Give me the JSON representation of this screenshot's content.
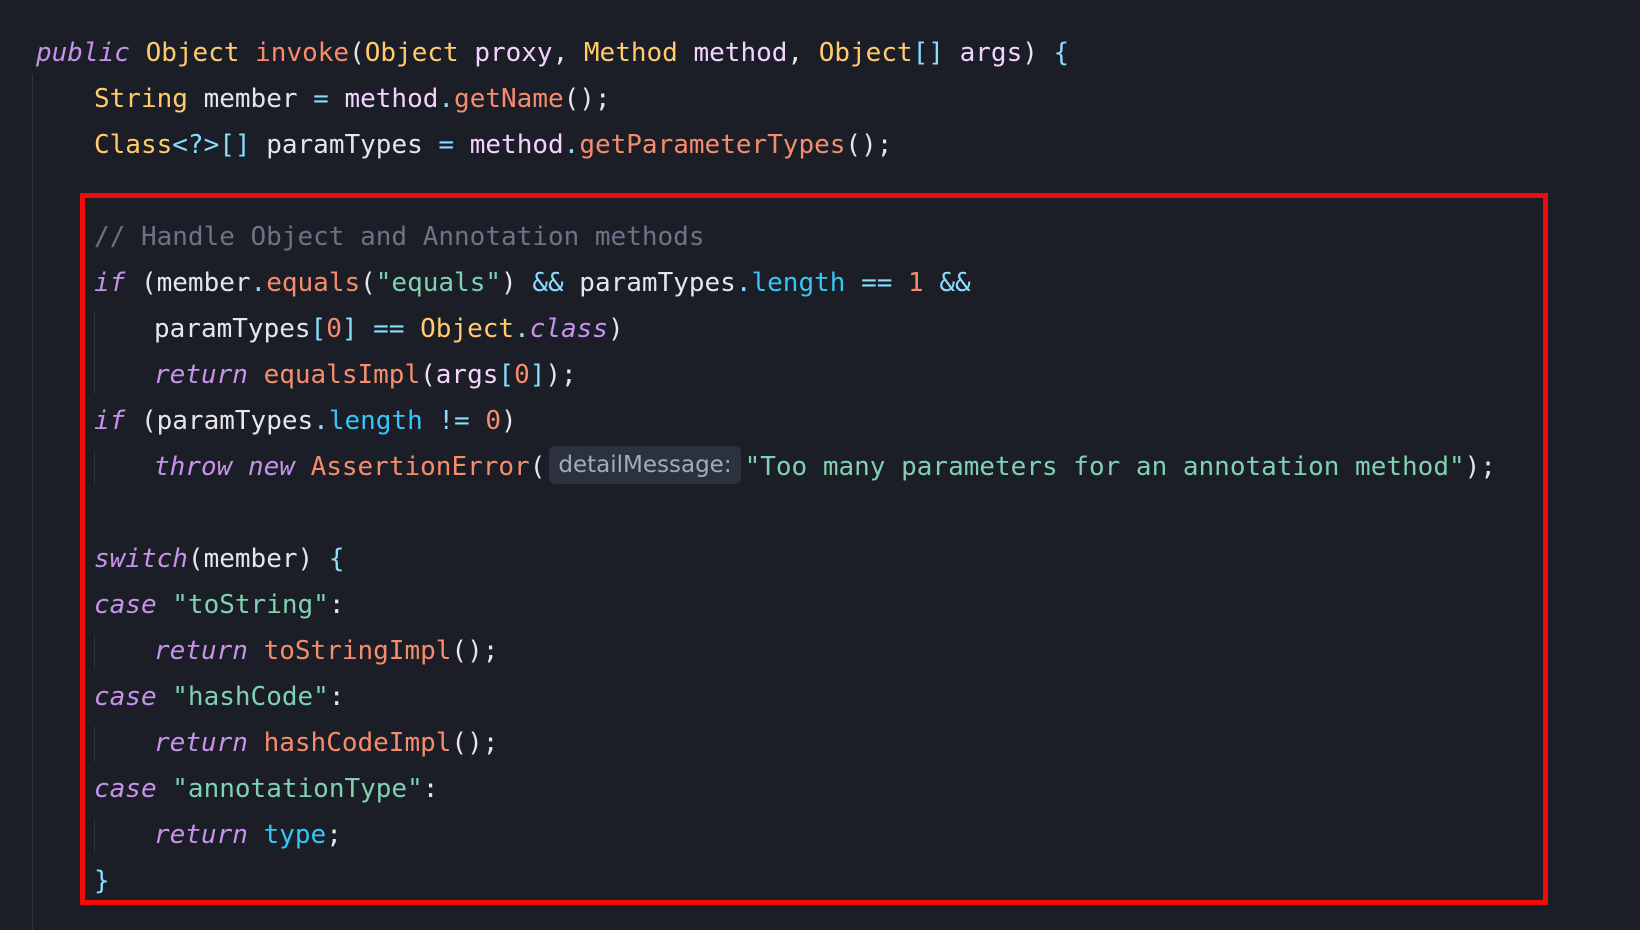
{
  "editor": {
    "colors": {
      "background": "#1b1e27",
      "keyword": "#c792ea",
      "type": "#ffcb6b",
      "function": "#f78c6c",
      "variable": "#f4d3ff",
      "punctuation": "#e6e6ea",
      "operator": "#89ddff",
      "string": "#7fd1b0",
      "number": "#f78c6c",
      "property": "#36c6f4",
      "comment": "#6b7386",
      "highlight_border": "#f20b0b"
    },
    "highlight": {
      "label": "selected-code-region"
    },
    "lines": [
      {
        "indent": 0,
        "tokens": [
          {
            "t": "public",
            "c": "keyword",
            "i": true
          },
          {
            "t": " "
          },
          {
            "t": "Object",
            "c": "type"
          },
          {
            "t": " "
          },
          {
            "t": "invoke",
            "c": "function"
          },
          {
            "t": "(",
            "c": "punctuation"
          },
          {
            "t": "Object",
            "c": "type"
          },
          {
            "t": " "
          },
          {
            "t": "proxy",
            "c": "variable"
          },
          {
            "t": ", ",
            "c": "punctuation"
          },
          {
            "t": "Method",
            "c": "type"
          },
          {
            "t": " "
          },
          {
            "t": "method",
            "c": "variable"
          },
          {
            "t": ", ",
            "c": "punctuation"
          },
          {
            "t": "Object",
            "c": "type"
          },
          {
            "t": "[]",
            "c": "operator"
          },
          {
            "t": " "
          },
          {
            "t": "args",
            "c": "variable"
          },
          {
            "t": ") ",
            "c": "punctuation"
          },
          {
            "t": "{",
            "c": "operator"
          }
        ]
      },
      {
        "indent": 1,
        "tokens": [
          {
            "t": "String",
            "c": "type"
          },
          {
            "t": " "
          },
          {
            "t": "member",
            "c": "punctuation"
          },
          {
            "t": " "
          },
          {
            "t": "=",
            "c": "operator"
          },
          {
            "t": " "
          },
          {
            "t": "method",
            "c": "variable"
          },
          {
            "t": ".",
            "c": "operator"
          },
          {
            "t": "getName",
            "c": "function"
          },
          {
            "t": "();",
            "c": "punctuation"
          }
        ]
      },
      {
        "indent": 1,
        "tokens": [
          {
            "t": "Class",
            "c": "type"
          },
          {
            "t": "<?>",
            "c": "operator"
          },
          {
            "t": "[]",
            "c": "operator"
          },
          {
            "t": " "
          },
          {
            "t": "paramTypes",
            "c": "punctuation"
          },
          {
            "t": " "
          },
          {
            "t": "=",
            "c": "operator"
          },
          {
            "t": " "
          },
          {
            "t": "method",
            "c": "variable"
          },
          {
            "t": ".",
            "c": "operator"
          },
          {
            "t": "getParameterTypes",
            "c": "function"
          },
          {
            "t": "();",
            "c": "punctuation"
          }
        ]
      },
      {
        "indent": 0,
        "tokens": []
      },
      {
        "indent": 1,
        "tokens": [
          {
            "t": "// Handle Object and Annotation methods",
            "c": "comment"
          }
        ]
      },
      {
        "indent": 1,
        "tokens": [
          {
            "t": "if",
            "c": "keyword",
            "i": true
          },
          {
            "t": " ("
          },
          {
            "t": "member",
            "c": "punctuation"
          },
          {
            "t": ".",
            "c": "operator"
          },
          {
            "t": "equals",
            "c": "function"
          },
          {
            "t": "(",
            "c": "punctuation"
          },
          {
            "t": "\"equals\"",
            "c": "string"
          },
          {
            "t": ") ",
            "c": "punctuation"
          },
          {
            "t": "&&",
            "c": "operator"
          },
          {
            "t": " "
          },
          {
            "t": "paramTypes",
            "c": "punctuation"
          },
          {
            "t": ".",
            "c": "operator"
          },
          {
            "t": "length",
            "c": "property"
          },
          {
            "t": " "
          },
          {
            "t": "==",
            "c": "operator"
          },
          {
            "t": " "
          },
          {
            "t": "1",
            "c": "number"
          },
          {
            "t": " "
          },
          {
            "t": "&&",
            "c": "operator"
          }
        ]
      },
      {
        "indent": 2,
        "tokens": [
          {
            "t": "paramTypes",
            "c": "punctuation"
          },
          {
            "t": "[",
            "c": "operator"
          },
          {
            "t": "0",
            "c": "number"
          },
          {
            "t": "]",
            "c": "operator"
          },
          {
            "t": " "
          },
          {
            "t": "==",
            "c": "operator"
          },
          {
            "t": " "
          },
          {
            "t": "Object",
            "c": "type"
          },
          {
            "t": ".",
            "c": "operator"
          },
          {
            "t": "class",
            "c": "keyword",
            "i": true
          },
          {
            "t": ")",
            "c": "punctuation"
          }
        ]
      },
      {
        "indent": 2,
        "tokens": [
          {
            "t": "return",
            "c": "keyword",
            "i": true
          },
          {
            "t": " "
          },
          {
            "t": "equalsImpl",
            "c": "function"
          },
          {
            "t": "(",
            "c": "punctuation"
          },
          {
            "t": "args",
            "c": "variable"
          },
          {
            "t": "[",
            "c": "operator"
          },
          {
            "t": "0",
            "c": "number"
          },
          {
            "t": "]",
            "c": "operator"
          },
          {
            "t": ");",
            "c": "punctuation"
          }
        ]
      },
      {
        "indent": 1,
        "tokens": [
          {
            "t": "if",
            "c": "keyword",
            "i": true
          },
          {
            "t": " ("
          },
          {
            "t": "paramTypes",
            "c": "punctuation"
          },
          {
            "t": ".",
            "c": "operator"
          },
          {
            "t": "length",
            "c": "property"
          },
          {
            "t": " "
          },
          {
            "t": "!=",
            "c": "operator"
          },
          {
            "t": " "
          },
          {
            "t": "0",
            "c": "number"
          },
          {
            "t": ")",
            "c": "punctuation"
          }
        ]
      },
      {
        "indent": 2,
        "tokens": [
          {
            "t": "throw",
            "c": "keyword",
            "i": true
          },
          {
            "t": " "
          },
          {
            "t": "new",
            "c": "keyword",
            "i": true
          },
          {
            "t": " "
          },
          {
            "t": "AssertionError",
            "c": "function"
          },
          {
            "t": "(",
            "c": "punctuation"
          },
          {
            "hint": "detailMessage:"
          },
          {
            "t": "\"Too many parameters for an annotation method\"",
            "c": "string"
          },
          {
            "t": ");",
            "c": "punctuation"
          }
        ]
      },
      {
        "indent": 0,
        "tokens": []
      },
      {
        "indent": 1,
        "tokens": [
          {
            "t": "switch",
            "c": "keyword",
            "i": true
          },
          {
            "t": "(",
            "c": "punctuation"
          },
          {
            "t": "member",
            "c": "punctuation"
          },
          {
            "t": ") ",
            "c": "punctuation"
          },
          {
            "t": "{",
            "c": "operator"
          }
        ]
      },
      {
        "indent": 1,
        "tokens": [
          {
            "t": "case",
            "c": "keyword",
            "i": true
          },
          {
            "t": " "
          },
          {
            "t": "\"toString\"",
            "c": "string"
          },
          {
            "t": ":",
            "c": "punctuation"
          }
        ]
      },
      {
        "indent": 2,
        "tokens": [
          {
            "t": "return",
            "c": "keyword",
            "i": true
          },
          {
            "t": " "
          },
          {
            "t": "toStringImpl",
            "c": "function"
          },
          {
            "t": "();",
            "c": "punctuation"
          }
        ]
      },
      {
        "indent": 1,
        "tokens": [
          {
            "t": "case",
            "c": "keyword",
            "i": true
          },
          {
            "t": " "
          },
          {
            "t": "\"hashCode\"",
            "c": "string"
          },
          {
            "t": ":",
            "c": "punctuation"
          }
        ]
      },
      {
        "indent": 2,
        "tokens": [
          {
            "t": "return",
            "c": "keyword",
            "i": true
          },
          {
            "t": " "
          },
          {
            "t": "hashCodeImpl",
            "c": "function"
          },
          {
            "t": "();",
            "c": "punctuation"
          }
        ]
      },
      {
        "indent": 1,
        "tokens": [
          {
            "t": "case",
            "c": "keyword",
            "i": true
          },
          {
            "t": " "
          },
          {
            "t": "\"annotationType\"",
            "c": "string"
          },
          {
            "t": ":",
            "c": "punctuation"
          }
        ]
      },
      {
        "indent": 2,
        "tokens": [
          {
            "t": "return",
            "c": "keyword",
            "i": true
          },
          {
            "t": " "
          },
          {
            "t": "type",
            "c": "property"
          },
          {
            "t": ";",
            "c": "punctuation"
          }
        ]
      },
      {
        "indent": 1,
        "tokens": [
          {
            "t": "}",
            "c": "operator"
          }
        ]
      }
    ]
  }
}
